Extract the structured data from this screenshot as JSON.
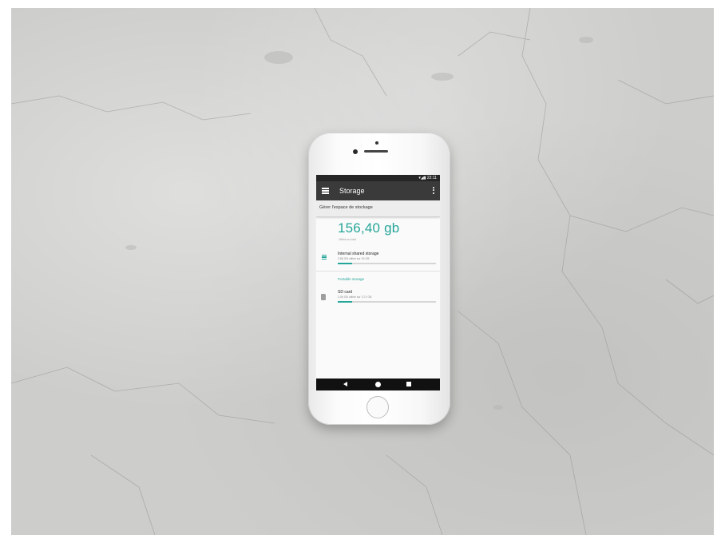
{
  "status_bar": {
    "time": "22:11",
    "icons": "▾◢▮"
  },
  "app_bar": {
    "title": "Storage",
    "menu_icon": "menu-icon",
    "overflow_icon": "more-vert-icon"
  },
  "subheader": {
    "text": "Gérer l'espace de stockage"
  },
  "summary": {
    "total": "156,40 gb",
    "caption": "Utilisé au total"
  },
  "internal": {
    "title": "Internal shared storage",
    "subtitle": "2,88 GB utilisé sur 29 GB",
    "used_fraction": 0.15,
    "icon": "storage-icon"
  },
  "portable": {
    "section_label": "Portable storage",
    "title": "SD card",
    "subtitle": "2,06 GB utilisé sur 3,71 GB",
    "used_fraction": 0.15,
    "icon": "sd-card-icon"
  },
  "nav": {
    "back_icon": "back-icon",
    "home_icon": "home-icon",
    "recent_icon": "recent-apps-icon"
  },
  "colors": {
    "accent": "#26a69a",
    "app_bar": "#3a3a3a",
    "nav_bar": "#111111",
    "background": "#cdcdcb"
  }
}
